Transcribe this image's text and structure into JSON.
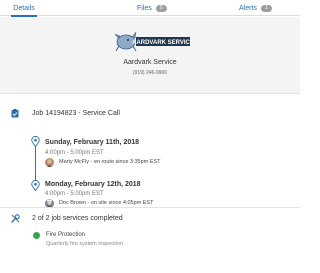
{
  "tabs": [
    {
      "label": "Details"
    },
    {
      "label": "Files",
      "count": "0"
    },
    {
      "label": "Alerts",
      "count": "1"
    }
  ],
  "company": {
    "logo_text": "AARDVARK SERVICE",
    "name": "Aardvark Service",
    "phone": "(919) 246-9900"
  },
  "job": {
    "title": "Job 14194823 - Service Call"
  },
  "timeline": [
    {
      "date": "Sunday, February 11th, 2018",
      "time": "4:00pm - 5:00pm EST",
      "person": "Marty McFly - en route since 3:35pm EST"
    },
    {
      "date": "Monday, February 12th, 2018",
      "time": "4:00pm - 5:00pm EST",
      "person": "Doc Brown - on site since 4:05pm EST"
    }
  ],
  "services": {
    "summary": "2 of 2 job services completed",
    "items": [
      {
        "name": "Fire Protection",
        "desc": "Quarterly fire system inspection",
        "status_color": "#2fa84f"
      }
    ]
  },
  "colors": {
    "accent": "#2a72b5",
    "complete": "#2fa84f",
    "header_bg": "#f4f4f4"
  }
}
